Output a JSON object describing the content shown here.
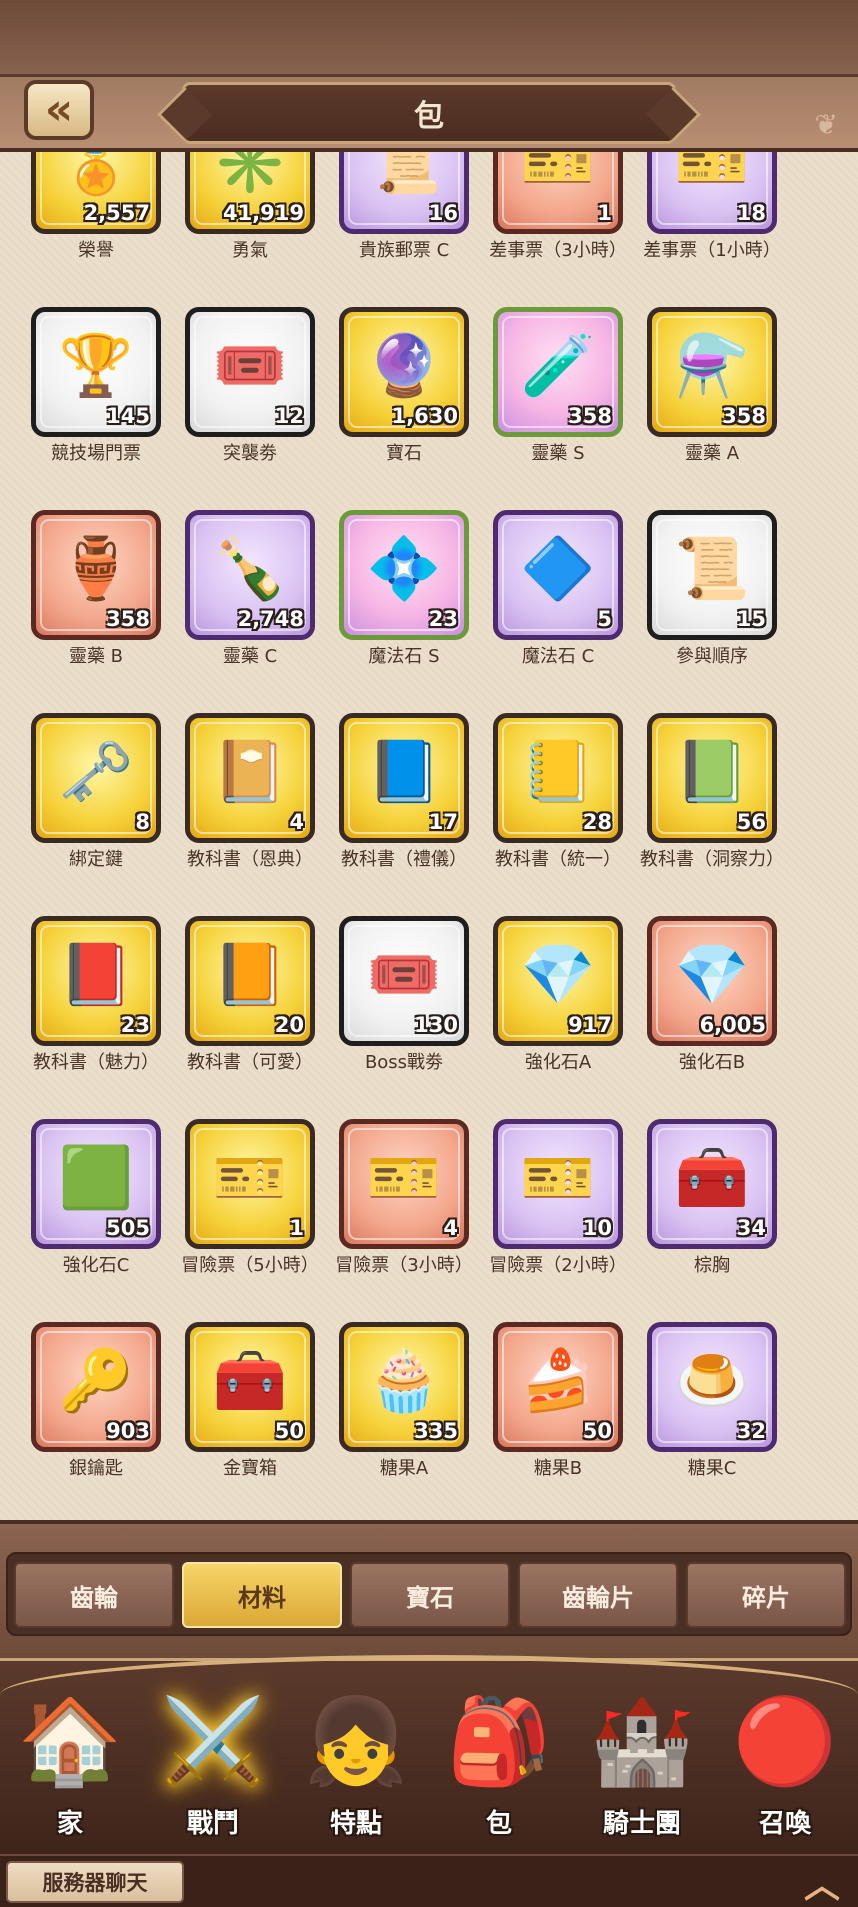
{
  "header": {
    "title": "包",
    "back_icon": "double-chevron-left-icon"
  },
  "grid": {
    "items": [
      {
        "label": "榮譽",
        "count": "2,557",
        "frame": "gold",
        "icon": "🏅"
      },
      {
        "label": "勇氣",
        "count": "41,919",
        "frame": "gold",
        "icon": "✳️"
      },
      {
        "label": "貴族郵票 C",
        "count": "16",
        "frame": "purple",
        "icon": "📜"
      },
      {
        "label": "差事票（3小時）",
        "count": "1",
        "frame": "red",
        "icon": "🎫"
      },
      {
        "label": "差事票（1小時）",
        "count": "18",
        "frame": "purple",
        "icon": "🎫"
      },
      {
        "label": "競技場門票",
        "count": "145",
        "frame": "white",
        "icon": "🏆"
      },
      {
        "label": "突襲劵",
        "count": "12",
        "frame": "white",
        "icon": "🎟️"
      },
      {
        "label": "寶石",
        "count": "1,630",
        "frame": "gold",
        "icon": "🔮"
      },
      {
        "label": "靈藥 S",
        "count": "358",
        "frame": "rainbow",
        "icon": "🧪"
      },
      {
        "label": "靈藥 A",
        "count": "358",
        "frame": "gold",
        "icon": "⚗️"
      },
      {
        "label": "靈藥 B",
        "count": "358",
        "frame": "red",
        "icon": "🏺"
      },
      {
        "label": "靈藥 C",
        "count": "2,748",
        "frame": "purple",
        "icon": "🍾"
      },
      {
        "label": "魔法石 S",
        "count": "23",
        "frame": "rainbow",
        "icon": "💠"
      },
      {
        "label": "魔法石 C",
        "count": "5",
        "frame": "purple",
        "icon": "🔷"
      },
      {
        "label": "參與順序",
        "count": "15",
        "frame": "white",
        "icon": "📜"
      },
      {
        "label": "綁定鍵",
        "count": "8",
        "frame": "gold",
        "icon": "🗝️"
      },
      {
        "label": "教科書（恩典）",
        "count": "4",
        "frame": "gold",
        "icon": "📔"
      },
      {
        "label": "教科書（禮儀）",
        "count": "17",
        "frame": "gold",
        "icon": "📘"
      },
      {
        "label": "教科書（統一）",
        "count": "28",
        "frame": "gold",
        "icon": "📒"
      },
      {
        "label": "教科書（洞察力）",
        "count": "56",
        "frame": "gold",
        "icon": "📗"
      },
      {
        "label": "教科書（魅力）",
        "count": "23",
        "frame": "gold",
        "icon": "📕"
      },
      {
        "label": "教科書（可愛）",
        "count": "20",
        "frame": "gold",
        "icon": "📙"
      },
      {
        "label": "Boss戰劵",
        "count": "130",
        "frame": "white",
        "icon": "🎟️"
      },
      {
        "label": "強化石A",
        "count": "917",
        "frame": "gold",
        "icon": "💎"
      },
      {
        "label": "強化石B",
        "count": "6,005",
        "frame": "red",
        "icon": "💎"
      },
      {
        "label": "強化石C",
        "count": "505",
        "frame": "purple",
        "icon": "🟩"
      },
      {
        "label": "冒險票（5小時）",
        "count": "1",
        "frame": "gold",
        "icon": "🎫"
      },
      {
        "label": "冒險票（3小時）",
        "count": "4",
        "frame": "red",
        "icon": "🎫"
      },
      {
        "label": "冒險票（2小時）",
        "count": "10",
        "frame": "purple",
        "icon": "🎫"
      },
      {
        "label": "棕胸",
        "count": "34",
        "frame": "purple",
        "icon": "🧰"
      },
      {
        "label": "銀鑰匙",
        "count": "903",
        "frame": "red",
        "icon": "🔑"
      },
      {
        "label": "金寶箱",
        "count": "50",
        "frame": "gold",
        "icon": "🧰"
      },
      {
        "label": "糖果A",
        "count": "335",
        "frame": "gold",
        "icon": "🧁"
      },
      {
        "label": "糖果B",
        "count": "50",
        "frame": "red",
        "icon": "🍰"
      },
      {
        "label": "糖果C",
        "count": "32",
        "frame": "purple",
        "icon": "🍮"
      }
    ]
  },
  "tabs": [
    {
      "label": "齒輪",
      "active": false
    },
    {
      "label": "材料",
      "active": true
    },
    {
      "label": "寶石",
      "active": false
    },
    {
      "label": "齒輪片",
      "active": false
    },
    {
      "label": "碎片",
      "active": false
    }
  ],
  "nav": [
    {
      "label": "家",
      "icon": "🏠",
      "name": "home"
    },
    {
      "label": "戰鬥",
      "icon": "⚔️",
      "name": "battle"
    },
    {
      "label": "特點",
      "icon": "👧",
      "name": "traits"
    },
    {
      "label": "包",
      "icon": "🎒",
      "name": "bag"
    },
    {
      "label": "騎士團",
      "icon": "🏰",
      "name": "order"
    },
    {
      "label": "召喚",
      "icon": "🔴",
      "name": "summon"
    }
  ],
  "chat": {
    "button_label": "服務器聊天",
    "expand_icon": "chevron-up-icon"
  }
}
